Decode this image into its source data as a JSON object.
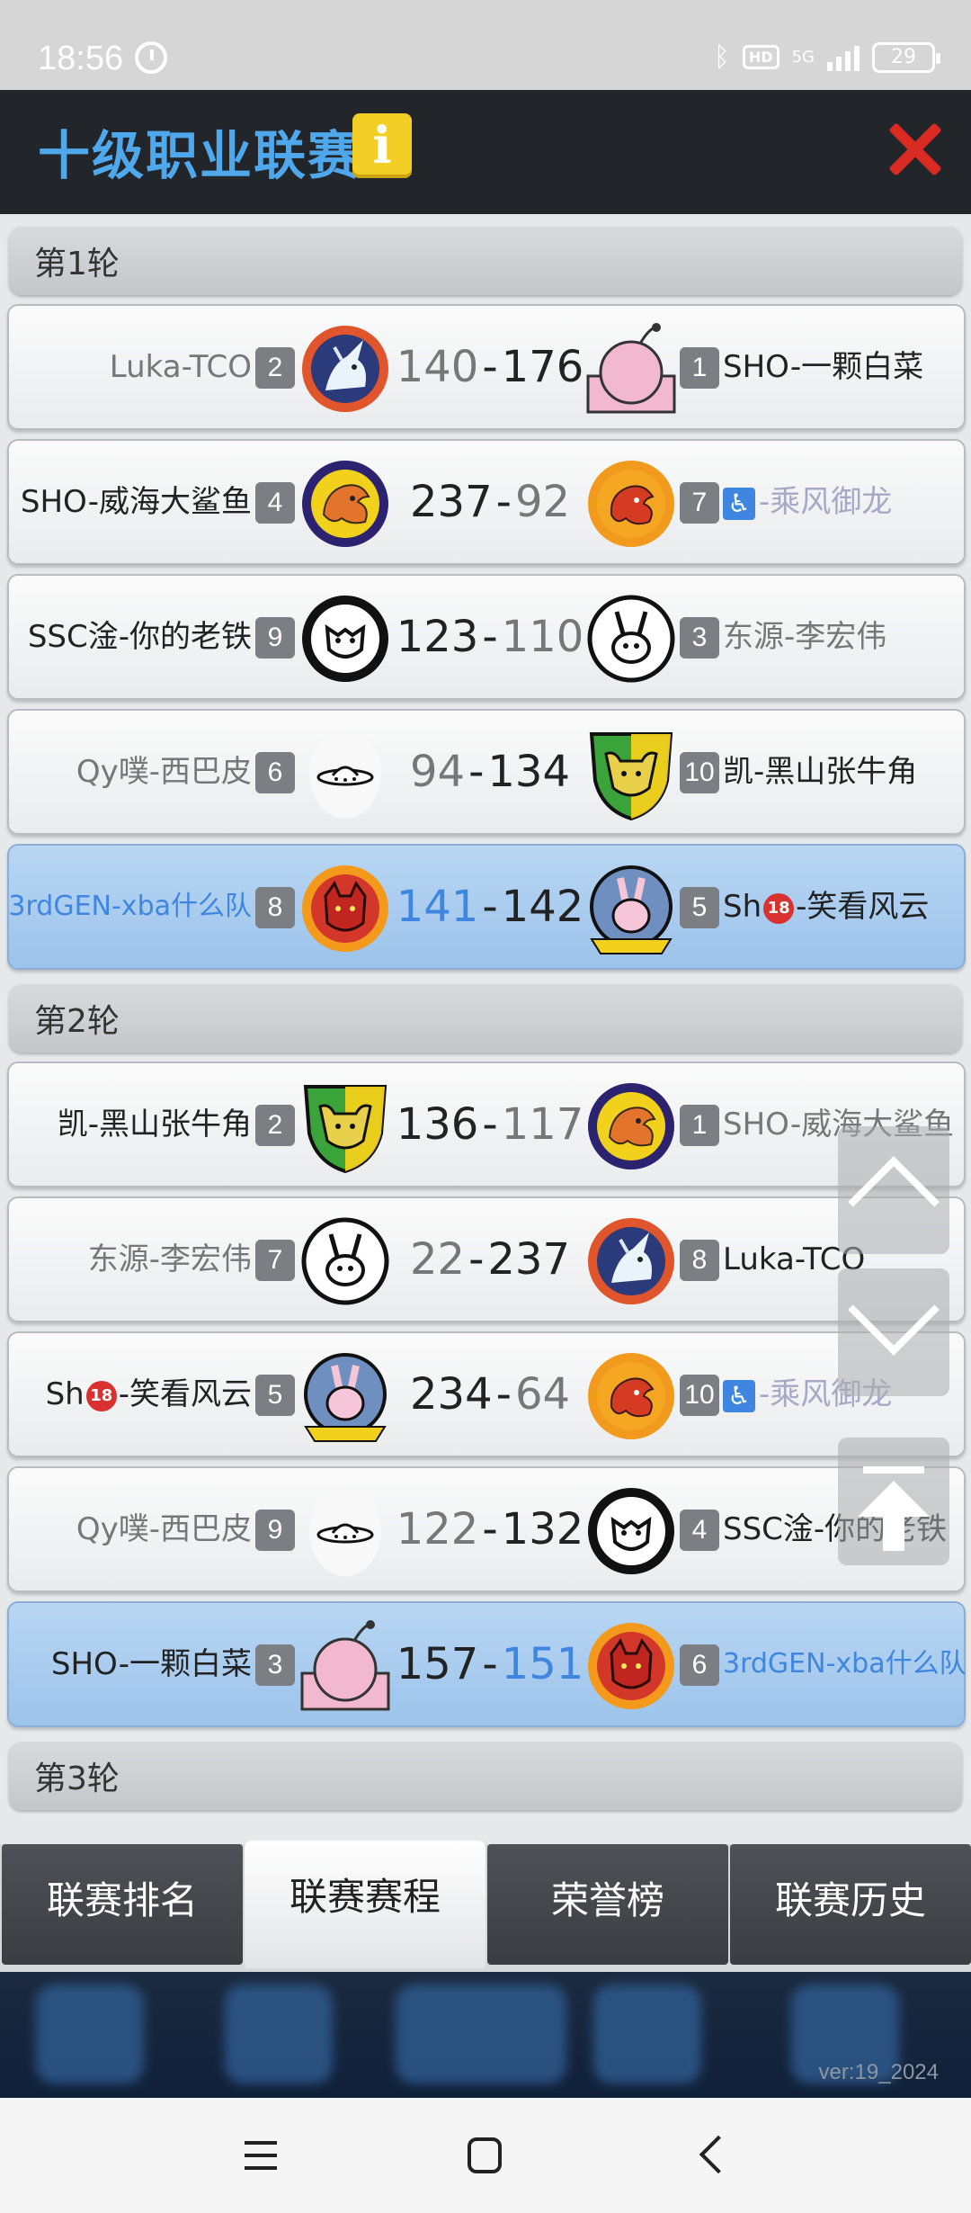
{
  "status_bar": {
    "time": "18:56",
    "network": "5G",
    "hd": "HD",
    "battery": "29"
  },
  "header": {
    "title": "十级职业联赛",
    "info_icon": "info-icon",
    "close_icon": "close-icon"
  },
  "rounds": [
    {
      "label": "第1轮",
      "matches": [
        {
          "left_team": "Luka-TCO",
          "left_rank": "2",
          "left_logo": "unicorn-logo",
          "left_score": "140",
          "right_score": "176",
          "right_rank": "1",
          "right_team": "SHO-一颗白菜",
          "right_logo": "bomb-logo"
        },
        {
          "left_team": "SHO-威海大鲨鱼",
          "left_rank": "4",
          "left_logo": "yellow-dragon-logo",
          "left_score": "237",
          "right_score": "92",
          "right_rank": "7",
          "right_team": "-乘风御龙",
          "right_logo": "orange-dragon-logo"
        },
        {
          "left_team": "SSC淦-你的老铁",
          "left_rank": "9",
          "left_logo": "gear-beast-logo",
          "left_score": "123",
          "right_score": "110",
          "right_rank": "3",
          "right_team": "东源-李宏伟",
          "right_logo": "rabbit-logo"
        },
        {
          "left_team": "Qy噗-西巴皮",
          "left_rank": "6",
          "left_logo": "ufo-logo",
          "left_score": "94",
          "right_score": "134",
          "right_rank": "10",
          "right_team": "凯-黑山张牛角",
          "right_logo": "bull-shield-logo"
        },
        {
          "left_team": "3rdGEN-xba什么队",
          "left_rank": "8",
          "left_logo": "wolf-logo",
          "left_score": "141",
          "right_score": "142",
          "right_rank": "5",
          "right_team": "-笑看风云",
          "right_logo": "bunny-logo"
        }
      ]
    },
    {
      "label": "第2轮",
      "matches": [
        {
          "left_team": "凯-黑山张牛角",
          "left_rank": "2",
          "left_logo": "bull-shield-logo",
          "left_score": "136",
          "right_score": "117",
          "right_rank": "1",
          "right_team": "SHO-威海大鲨鱼",
          "right_logo": "yellow-dragon-logo"
        },
        {
          "left_team": "东源-李宏伟",
          "left_rank": "7",
          "left_logo": "rabbit-logo",
          "left_score": "22",
          "right_score": "237",
          "right_rank": "8",
          "right_team": "Luka-TCO",
          "right_logo": "unicorn-logo"
        },
        {
          "left_team": "-笑看风云",
          "left_rank": "5",
          "left_logo": "bunny-logo",
          "left_score": "234",
          "right_score": "64",
          "right_rank": "10",
          "right_team": "-乘风御龙",
          "right_logo": "orange-dragon-logo"
        },
        {
          "left_team": "Qy噗-西巴皮",
          "left_rank": "9",
          "left_logo": "ufo-logo",
          "left_score": "122",
          "right_score": "132",
          "right_rank": "4",
          "right_team": "SSC淦-你的老铁",
          "right_logo": "gear-beast-logo"
        },
        {
          "left_team": "SHO-一颗白菜",
          "left_rank": "3",
          "left_logo": "bomb-logo",
          "left_score": "157",
          "right_score": "151",
          "right_rank": "6",
          "right_team": "3rdGEN-xba什么队",
          "right_logo": "wolf-logo"
        }
      ]
    },
    {
      "label": "第3轮",
      "matches": []
    }
  ],
  "name_prefixes": {
    "sh": "Sh",
    "badge18": "18",
    "accessible": "♿"
  },
  "tabs": [
    "联赛排名",
    "联赛赛程",
    "荣誉榜",
    "联赛历史"
  ],
  "active_tab": "联赛赛程",
  "footer": {
    "version": "ver:19_2024"
  },
  "colors": {
    "header_title": "#4fa8ec",
    "highlight_row": "#a9cdef",
    "close": "#d92b22",
    "info": "#f3cf25"
  }
}
